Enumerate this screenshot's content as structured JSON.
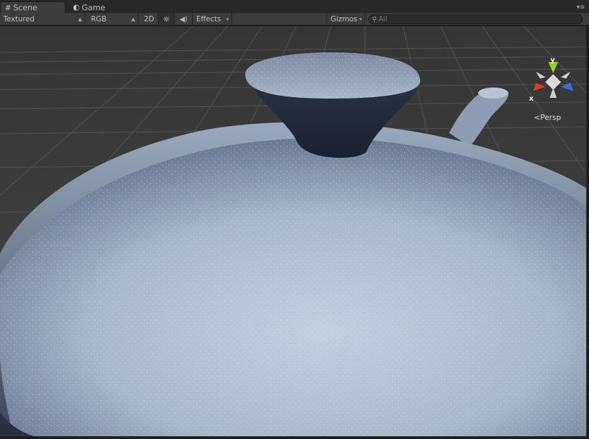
{
  "tabs": [
    {
      "label": "Scene",
      "icon": "scene-grid-icon",
      "active": true
    },
    {
      "label": "Game",
      "icon": "game-icon",
      "active": false
    }
  ],
  "toolbar": {
    "draw_mode": "Textured",
    "render_mode": "RGB",
    "toggle_2d": "2D",
    "lighting_icon": "sun-icon",
    "audio_icon": "speaker-icon",
    "effects": "Effects",
    "gizmos": "Gizmos"
  },
  "search": {
    "placeholder": "All",
    "value": ""
  },
  "scene_gizmo": {
    "axis_y": "y",
    "axis_x": "x",
    "projection": "Persp",
    "colors": {
      "y": "#8fd62a",
      "x": "#e03a2a",
      "z": "#3a6ee0"
    }
  },
  "colors": {
    "panel_bg": "#3c3c3c",
    "viewport_bg": "#404040",
    "teapot": "#a8b6c8"
  }
}
